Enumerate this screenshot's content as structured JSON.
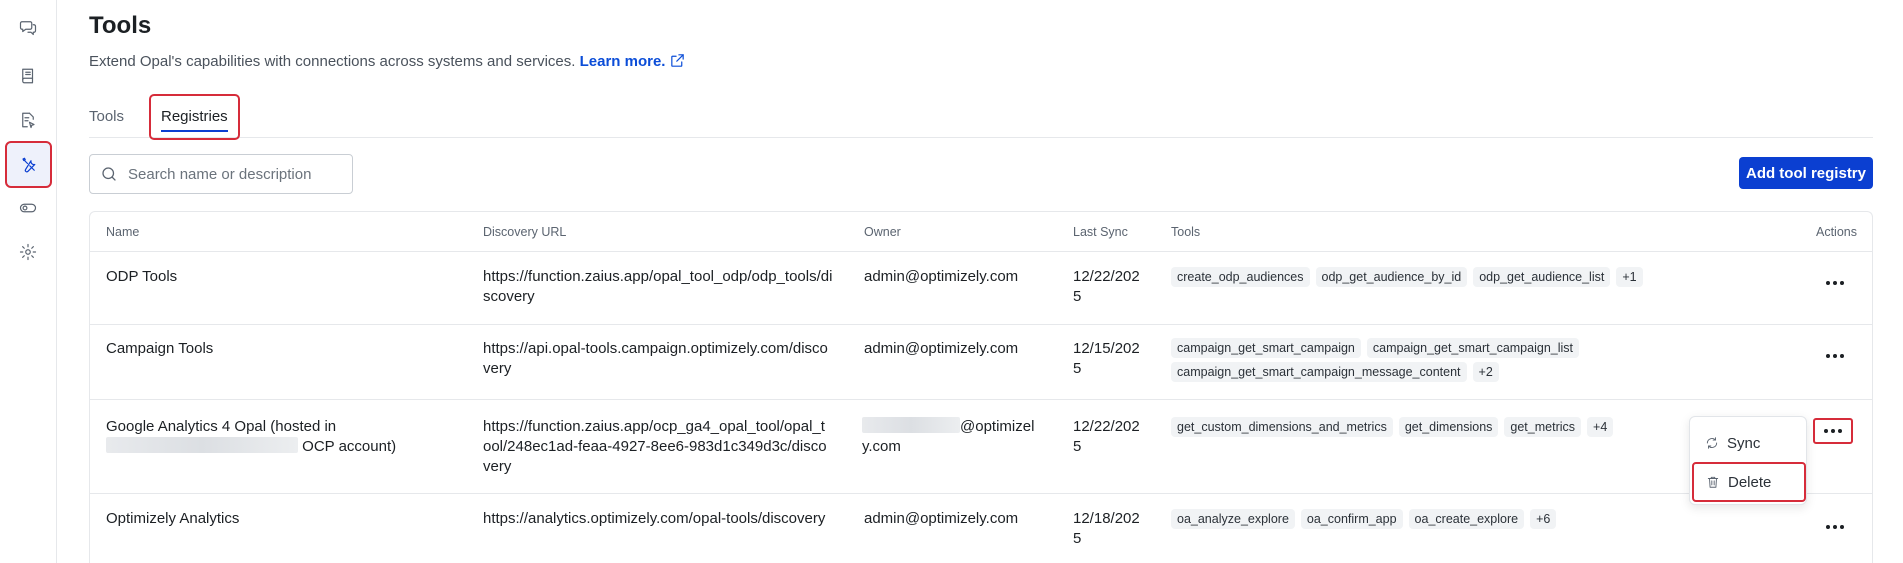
{
  "page": {
    "title": "Tools",
    "description": "Extend Opal's capabilities with connections across systems and services.",
    "learn_more": "Learn more."
  },
  "tabs": [
    {
      "label": "Tools"
    },
    {
      "label": "Registries",
      "active": true
    }
  ],
  "search": {
    "placeholder": "Search name or description",
    "value": ""
  },
  "toolbar": {
    "add_label": "Add tool registry"
  },
  "table": {
    "headers": {
      "name": "Name",
      "url": "Discovery URL",
      "owner": "Owner",
      "last_sync": "Last Sync",
      "tools": "Tools",
      "actions": "Actions"
    },
    "rows": [
      {
        "name": "ODP Tools",
        "url": "https://function.zaius.app/opal_tool_odp/odp_tools/discovery",
        "owner": "admin@optimizely.com",
        "last_sync": "12/22/2025",
        "tools": [
          "create_odp_audiences",
          "odp_get_audience_by_id",
          "odp_get_audience_list"
        ],
        "more": "+1"
      },
      {
        "name": "Campaign Tools",
        "url": "https://api.opal-tools.campaign.optimizely.com/discovery",
        "owner": "admin@optimizely.com",
        "last_sync": "12/15/2025",
        "tools": [
          "campaign_get_smart_campaign",
          "campaign_get_smart_campaign_list",
          "campaign_get_smart_campaign_message_content"
        ],
        "more": "+2"
      },
      {
        "name_prefix": "Google Analytics 4 Opal (hosted in",
        "name_suffix": "OCP account)",
        "url": "https://function.zaius.app/ocp_ga4_opal_tool/opal_tool/248ec1ad-feaa-4927-8ee6-983d1c349d3c/discovery",
        "owner_suffix": "@optimizely.com",
        "last_sync": "12/22/2025",
        "tools": [
          "get_custom_dimensions_and_metrics",
          "get_dimensions",
          "get_metrics"
        ],
        "more": "+4"
      },
      {
        "name": "Optimizely Analytics",
        "url": "https://analytics.optimizely.com/opal-tools/discovery",
        "owner": "admin@optimizely.com",
        "last_sync": "12/18/2025",
        "tools": [
          "oa_analyze_explore",
          "oa_confirm_app",
          "oa_create_explore"
        ],
        "more": "+6"
      }
    ]
  },
  "menu": {
    "sync_label": "Sync",
    "delete_label": "Delete"
  },
  "icons": {
    "rail": [
      "chat-icon",
      "book-icon",
      "document-edit-icon",
      "tools-icon",
      "toggle-icon",
      "gear-icon"
    ]
  },
  "colors": {
    "accent": "#0b3fd1",
    "highlight": "#d62c3a"
  }
}
